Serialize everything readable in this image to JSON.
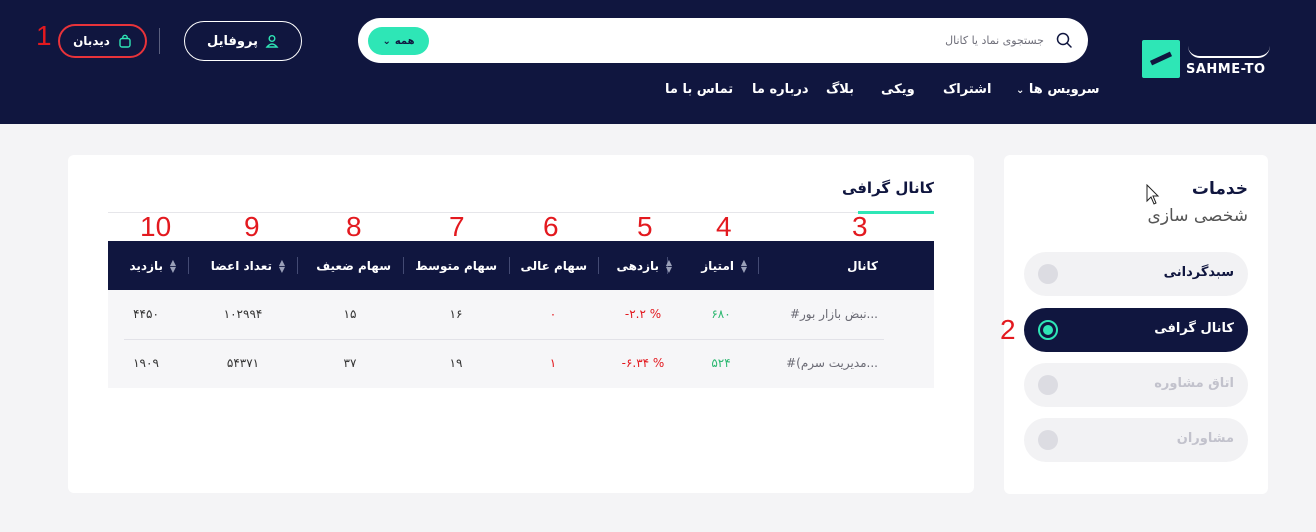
{
  "header": {
    "logo_text": "SAHME-TO",
    "search": {
      "placeholder": "جستجوی نماد یا کانال",
      "filter_label": "همه"
    },
    "nav": [
      {
        "label": "سرویس ها"
      },
      {
        "label": "اشتراک"
      },
      {
        "label": "ویکی"
      },
      {
        "label": "بلاگ"
      },
      {
        "label": "درباره ما"
      },
      {
        "label": "تماس با ما"
      }
    ],
    "profile_label": "پروفایل",
    "watchlist_label": "دیدبان"
  },
  "annotations": [
    "1",
    "2",
    "3",
    "4",
    "5",
    "6",
    "7",
    "8",
    "9",
    "10"
  ],
  "sidebar": {
    "title": "خدمات",
    "subtitle": "شخصی سازی",
    "items": [
      {
        "label": "سبدگردانی",
        "state": "normal"
      },
      {
        "label": "کانال گرافی",
        "state": "active"
      },
      {
        "label": "اتاق مشاوره",
        "state": "disabled"
      },
      {
        "label": "مشاوران",
        "state": "disabled"
      }
    ]
  },
  "main": {
    "tab_title": "کانال گرافی",
    "table": {
      "columns": [
        "کانال",
        "امتیاز",
        "بازدهی",
        "سهام عالی",
        "سهام متوسط",
        "سهام ضعیف",
        "تعداد اعضا",
        "بازدید"
      ],
      "rows": [
        {
          "channel": "#نبض بازار بور...",
          "score": "۶۸۰",
          "return": "-۲.۲ %",
          "excellent": "۰",
          "medium": "۱۶",
          "weak": "۱۵",
          "members": "۱۰۲۹۹۴",
          "views": "۴۴۵۰"
        },
        {
          "channel": "#(مدیریت سرم...",
          "score": "۵۲۴",
          "return": "-۶.۳۴ %",
          "excellent": "۱",
          "medium": "۱۹",
          "weak": "۳۷",
          "members": "۵۴۳۷۱",
          "views": "۱۹۰۹"
        }
      ]
    }
  },
  "colors": {
    "navy": "#10163f",
    "accent": "#2ee6b6",
    "positive": "#2eb872",
    "negative": "#e3191f",
    "annotation": "#e3191f"
  }
}
